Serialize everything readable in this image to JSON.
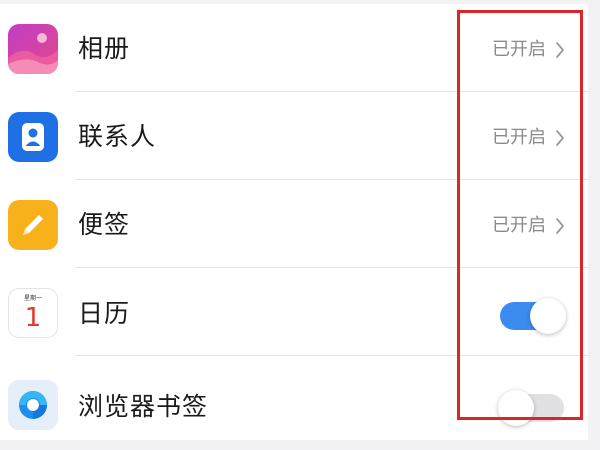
{
  "colors": {
    "toggle_on": "#3a8cf0",
    "toggle_off": "#e1e1e3",
    "highlight": "#d9262b",
    "status_text": "#8a8a8a"
  },
  "rows": [
    {
      "label": "相册",
      "icon": "photos-icon",
      "status": "已开启",
      "type": "link"
    },
    {
      "label": "联系人",
      "icon": "contacts-icon",
      "status": "已开启",
      "type": "link"
    },
    {
      "label": "便签",
      "icon": "notes-icon",
      "status": "已开启",
      "type": "link"
    },
    {
      "label": "日历",
      "icon": "calendar-icon",
      "calendar_header": "星期一",
      "calendar_day": "1",
      "type": "toggle",
      "enabled": true
    },
    {
      "label": "浏览器书签",
      "icon": "browser-icon",
      "type": "toggle",
      "enabled": false
    }
  ]
}
